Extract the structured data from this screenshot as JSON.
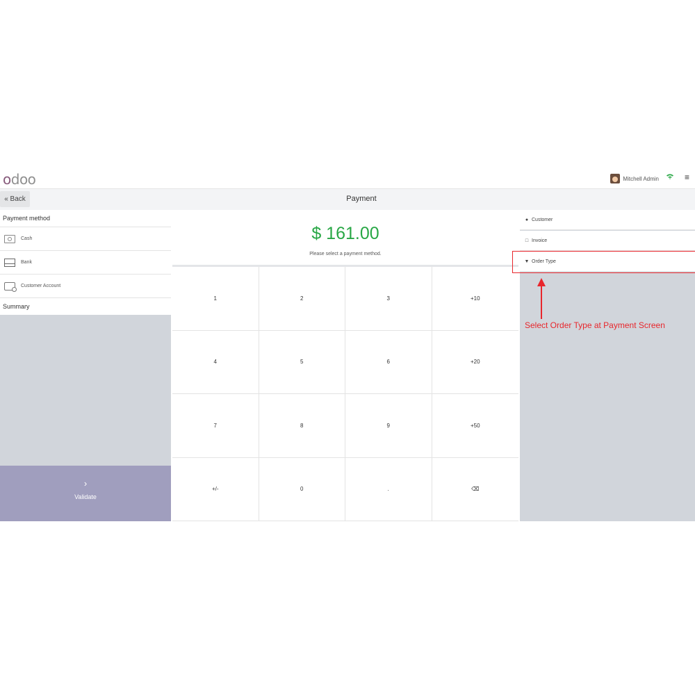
{
  "navbar": {
    "logo_text": "odoo",
    "user_name": "Mitchell Admin"
  },
  "control": {
    "back_label": "« Back",
    "title": "Payment"
  },
  "payment_methods": {
    "header": "Payment method",
    "items": [
      {
        "label": "Cash",
        "icon": "cash-icon"
      },
      {
        "label": "Bank",
        "icon": "bank-icon"
      },
      {
        "label": "Customer Account",
        "icon": "customer-account-icon"
      }
    ]
  },
  "summary": {
    "header": "Summary"
  },
  "validate": {
    "chevron": "›",
    "label": "Validate"
  },
  "amount": {
    "value": "$ 161.00",
    "hint": "Please select a payment method."
  },
  "numpad": {
    "keys": [
      "1",
      "2",
      "3",
      "+10",
      "4",
      "5",
      "6",
      "+20",
      "7",
      "8",
      "9",
      "+50",
      "+/-",
      "0",
      ".",
      "⌫"
    ]
  },
  "side_buttons": {
    "customer": {
      "label": "Customer",
      "icon": "user-icon"
    },
    "invoice": {
      "label": "Invoice",
      "icon": "invoice-icon"
    },
    "order_type": {
      "label": "Order Type",
      "icon": "cart-icon"
    }
  },
  "annotation": {
    "text": "Select Order Type at Payment Screen"
  },
  "colors": {
    "amount": "#28a745",
    "validate_bg": "#a09ebe",
    "annotation": "#e8262c",
    "brand": "#875a7b"
  }
}
